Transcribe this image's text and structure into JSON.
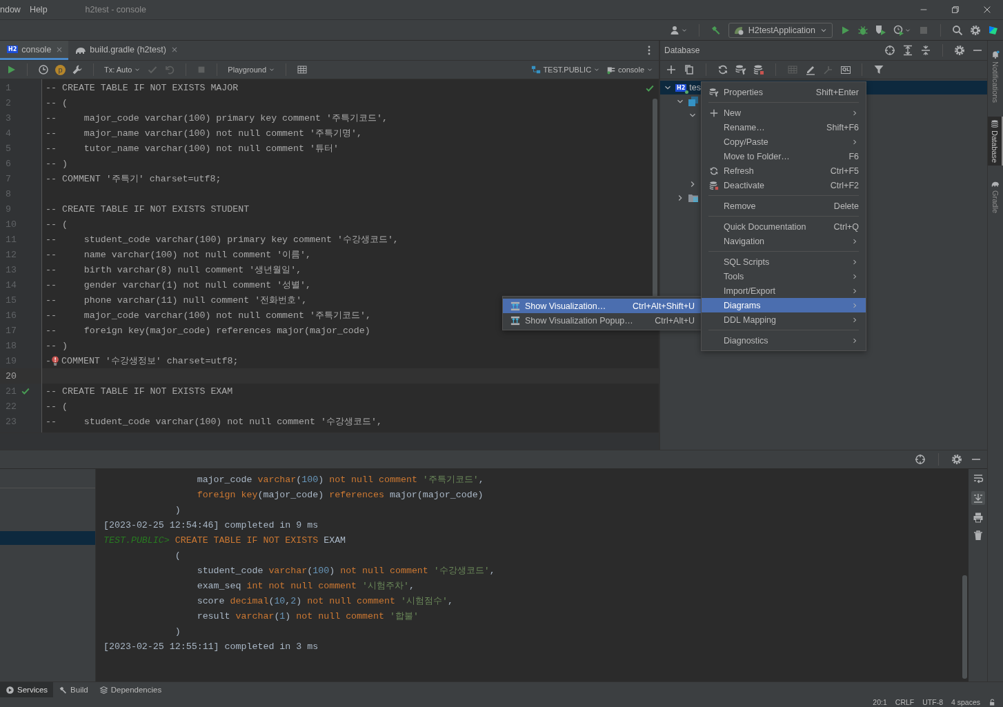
{
  "menu_bar": [
    "ndow",
    "Help"
  ],
  "window_title": "h2test - console",
  "run_config": "H2testApplication",
  "editor": {
    "tabs": [
      {
        "label": "console",
        "badge": "H2",
        "selected": true
      },
      {
        "label": "build.gradle (h2test)",
        "selected": false
      }
    ],
    "toolbar": {
      "profile_badge": "p",
      "tx_mode": "Tx: Auto",
      "mode": "Playground",
      "schema": "TEST.PUBLIC",
      "session": "console"
    },
    "lines": [
      {
        "number": "1",
        "kind": "code",
        "text": "-- CREATE TABLE IF NOT EXISTS MAJOR",
        "current": false
      },
      {
        "number": "2",
        "kind": "code",
        "text": "-- (",
        "current": false
      },
      {
        "number": "3",
        "kind": "code",
        "text": "--     major_code varchar(100) primary key comment '주특기코드',",
        "current": false
      },
      {
        "number": "4",
        "kind": "code",
        "text": "--     major_name varchar(100) not null comment '주특기명',",
        "current": false
      },
      {
        "number": "5",
        "kind": "code",
        "text": "--     tutor_name varchar(100) not null comment '튜터'",
        "current": false
      },
      {
        "number": "6",
        "kind": "code",
        "text": "-- )",
        "current": false
      },
      {
        "number": "7",
        "kind": "code",
        "text": "-- COMMENT '주특기' charset=utf8;",
        "current": false
      },
      {
        "number": "8",
        "kind": "code",
        "current": false
      },
      {
        "number": "9",
        "kind": "code",
        "text": "-- CREATE TABLE IF NOT EXISTS STUDENT",
        "current": false
      },
      {
        "number": "10",
        "kind": "code",
        "text": "-- (",
        "current": false
      },
      {
        "number": "11",
        "kind": "code",
        "text": "--     student_code varchar(100) primary key comment '수강생코드',",
        "current": false
      },
      {
        "number": "12",
        "kind": "code",
        "text": "--     name varchar(100) not null comment '이름',",
        "current": false
      },
      {
        "number": "13",
        "kind": "code",
        "text": "--     birth varchar(8) null comment '생년월일',",
        "current": false
      },
      {
        "number": "14",
        "kind": "code",
        "text": "--     gender varchar(1) not null comment '성별',",
        "current": false
      },
      {
        "number": "15",
        "kind": "code",
        "text": "--     phone varchar(11) null comment '전화번호',",
        "current": false
      },
      {
        "number": "16",
        "kind": "code",
        "text": "--     major_code varchar(100) not null comment '주특기코드',",
        "current": false
      },
      {
        "number": "17",
        "kind": "code",
        "text": "--     foreign key(major_code) references major(major_code)",
        "current": false
      },
      {
        "number": "18",
        "kind": "code",
        "text": "-- )",
        "current": false
      },
      {
        "number": "19",
        "kind": "error",
        "prefix": "-",
        "text": "COMMENT '수강생정보' charset=utf8;",
        "current": false
      },
      {
        "number": "20",
        "kind": "code",
        "current": true
      },
      {
        "number": "21",
        "kind": "verified",
        "text": "-- CREATE TABLE IF NOT EXISTS EXAM",
        "current": false
      },
      {
        "number": "22",
        "kind": "code",
        "text": "-- (",
        "current": false
      },
      {
        "number": "23",
        "kind": "code",
        "text": "--     student_code varchar(100) not null comment '수강생코드',",
        "current": false
      }
    ]
  },
  "database": {
    "title": "Database",
    "ql_label": "QL",
    "tree": [
      {
        "label": "tes",
        "badge": "H2",
        "expanded": true,
        "selected": true,
        "children": [
          {
            "expanded": true,
            "selected": false,
            "children": [
              {
                "expanded": true,
                "selected": false
              },
              {
                "expanded": false,
                "selected": false
              }
            ]
          },
          {
            "expanded": false,
            "selected": false
          }
        ]
      }
    ]
  },
  "context_menu": {
    "groups": [
      [
        {
          "label": "Properties",
          "shortcut": "Shift+Enter",
          "submenu": false,
          "selected": false
        }
      ],
      [
        {
          "label": "New",
          "submenu": true,
          "selected": false
        },
        {
          "label": "Rename…",
          "shortcut": "Shift+F6",
          "submenu": false,
          "selected": false
        },
        {
          "label": "Copy/Paste",
          "submenu": true,
          "selected": false
        },
        {
          "label": "Move to Folder…",
          "shortcut": "F6",
          "submenu": false,
          "selected": false
        },
        {
          "label": "Refresh",
          "shortcut": "Ctrl+F5",
          "submenu": false,
          "selected": false
        },
        {
          "label": "Deactivate",
          "shortcut": "Ctrl+F2",
          "submenu": false,
          "selected": false
        }
      ],
      [
        {
          "label": "Remove",
          "shortcut": "Delete",
          "submenu": false,
          "selected": false
        }
      ],
      [
        {
          "label": "Quick Documentation",
          "shortcut": "Ctrl+Q",
          "submenu": false,
          "selected": false
        },
        {
          "label": "Navigation",
          "submenu": true,
          "selected": false
        }
      ],
      [
        {
          "label": "SQL Scripts",
          "submenu": true,
          "selected": false
        },
        {
          "label": "Tools",
          "submenu": true,
          "selected": false
        },
        {
          "label": "Import/Export",
          "submenu": true,
          "selected": false
        },
        {
          "label": "Diagrams",
          "submenu": true,
          "selected": true
        },
        {
          "label": "DDL Mapping",
          "submenu": true,
          "selected": false
        }
      ],
      [
        {
          "label": "Diagnostics",
          "submenu": true,
          "selected": false
        }
      ]
    ]
  },
  "submenu": {
    "items": [
      {
        "label": "Show Visualization…",
        "shortcut": "Ctrl+Alt+Shift+U",
        "selected": true
      },
      {
        "label": "Show Visualization Popup…",
        "shortcut": "Ctrl+Alt+U",
        "selected": false
      }
    ]
  },
  "console": {
    "lines": [
      {
        "segments": [
          {
            "kind": "plain",
            "text": "                 major_code "
          },
          {
            "kind": "keyword",
            "text": "varchar"
          },
          {
            "kind": "plain",
            "text": "("
          },
          {
            "kind": "number",
            "text": "100"
          },
          {
            "kind": "plain",
            "text": ") "
          },
          {
            "kind": "keyword",
            "text": "not null comment "
          },
          {
            "kind": "string",
            "text": "'주특기코드'"
          },
          {
            "kind": "plain",
            "text": ","
          }
        ]
      },
      {
        "segments": [
          {
            "kind": "keyword",
            "text": "                 foreign key"
          },
          {
            "kind": "plain",
            "text": "(major_code) "
          },
          {
            "kind": "keyword",
            "text": "references"
          },
          {
            "kind": "plain",
            "text": " major(major_code)"
          }
        ]
      },
      {
        "segments": [
          {
            "kind": "plain",
            "text": "             )"
          }
        ]
      },
      {
        "segments": [
          {
            "kind": "plain",
            "text": "[2023-02-25 12:54:46] completed in 9 ms"
          }
        ]
      },
      {
        "segments": [
          {
            "kind": "prompt",
            "text": "TEST.PUBLIC> "
          },
          {
            "kind": "keyword",
            "text": "CREATE TABLE IF NOT EXISTS"
          },
          {
            "kind": "plain",
            "text": " EXAM"
          }
        ]
      },
      {
        "segments": [
          {
            "kind": "plain",
            "text": "             ("
          }
        ]
      },
      {
        "segments": [
          {
            "kind": "plain",
            "text": "                 student_code "
          },
          {
            "kind": "keyword",
            "text": "varchar"
          },
          {
            "kind": "plain",
            "text": "("
          },
          {
            "kind": "number",
            "text": "100"
          },
          {
            "kind": "plain",
            "text": ") "
          },
          {
            "kind": "keyword",
            "text": "not null comment "
          },
          {
            "kind": "string",
            "text": "'수강생코드'"
          },
          {
            "kind": "plain",
            "text": ","
          }
        ]
      },
      {
        "segments": [
          {
            "kind": "plain",
            "text": "                 exam_seq "
          },
          {
            "kind": "keyword",
            "text": "int not null comment "
          },
          {
            "kind": "string",
            "text": "'시험주차'"
          },
          {
            "kind": "plain",
            "text": ","
          }
        ]
      },
      {
        "segments": [
          {
            "kind": "plain",
            "text": "                 score "
          },
          {
            "kind": "keyword",
            "text": "decimal"
          },
          {
            "kind": "plain",
            "text": "("
          },
          {
            "kind": "number",
            "text": "10"
          },
          {
            "kind": "plain",
            "text": ","
          },
          {
            "kind": "number",
            "text": "2"
          },
          {
            "kind": "plain",
            "text": ") "
          },
          {
            "kind": "keyword",
            "text": "not null comment "
          },
          {
            "kind": "string",
            "text": "'시험점수'"
          },
          {
            "kind": "plain",
            "text": ","
          }
        ]
      },
      {
        "segments": [
          {
            "kind": "plain",
            "text": "                 result "
          },
          {
            "kind": "keyword",
            "text": "varchar"
          },
          {
            "kind": "plain",
            "text": "("
          },
          {
            "kind": "number",
            "text": "1"
          },
          {
            "kind": "plain",
            "text": ") "
          },
          {
            "kind": "keyword",
            "text": "not null comment "
          },
          {
            "kind": "string",
            "text": "'합불'"
          }
        ]
      },
      {
        "segments": [
          {
            "kind": "plain",
            "text": "             )"
          }
        ]
      },
      {
        "segments": [
          {
            "kind": "plain",
            "text": "[2023-02-25 12:55:11] completed in 3 ms"
          }
        ]
      }
    ]
  },
  "side_tabs": [
    {
      "label": "Notifications",
      "selected": false
    },
    {
      "label": "Database",
      "selected": true
    },
    {
      "label": "Gradle",
      "selected": false
    }
  ],
  "tool_tabs": [
    {
      "label": "Services",
      "selected": true
    },
    {
      "label": "Build",
      "selected": false
    },
    {
      "label": "Dependencies",
      "selected": false
    }
  ],
  "status_bar": [
    "20:1",
    "CRLF",
    "UTF-8",
    "4 spaces"
  ]
}
